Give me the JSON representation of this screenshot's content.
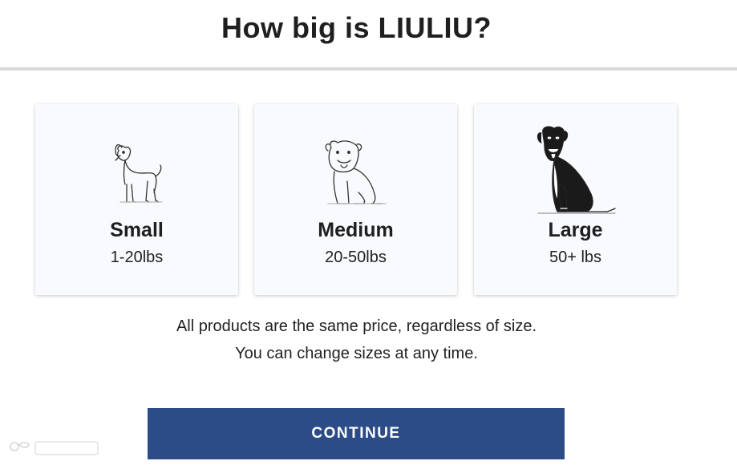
{
  "header": {
    "title": "How big is LIULIU?"
  },
  "sizes": [
    {
      "label": "Small",
      "range": "1-20lbs",
      "icon": "small-dog-icon"
    },
    {
      "label": "Medium",
      "range": "20-50lbs",
      "icon": "medium-dog-icon"
    },
    {
      "label": "Large",
      "range": "50+ lbs",
      "icon": "large-dog-icon"
    }
  ],
  "info": {
    "line1": "All products are the same price, regardless of size.",
    "line2": "You can change sizes at any time."
  },
  "continue_label": "CONTINUE",
  "colors": {
    "button": "#2b4c87",
    "card_bg": "#f8fafd",
    "divider": "#d9d9d9"
  }
}
